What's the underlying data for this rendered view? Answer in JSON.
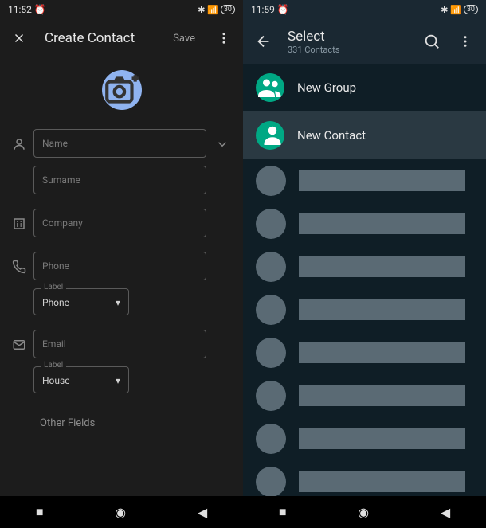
{
  "left": {
    "status": {
      "time": "11:52",
      "icons": "⏰ ⏱",
      "right": "✱ 📶 📶 🔋"
    },
    "title": "Create Contact",
    "save": "Save",
    "fields": {
      "name": "Name",
      "surname": "Surname",
      "company": "Company",
      "phone": "Phone",
      "phone_label": "Label",
      "phone_label_val": "Phone",
      "email": "Email",
      "email_label": "Label",
      "email_label_val": "House"
    },
    "other_fields": "Other Fields"
  },
  "right": {
    "status": {
      "time": "11:59",
      "icons": "⏰ ⏱",
      "right": "✱ 📶 📶 🔋"
    },
    "title": "Select",
    "subtitle": "331 Contacts",
    "new_group": "New Group",
    "new_contact": "New Contact"
  }
}
